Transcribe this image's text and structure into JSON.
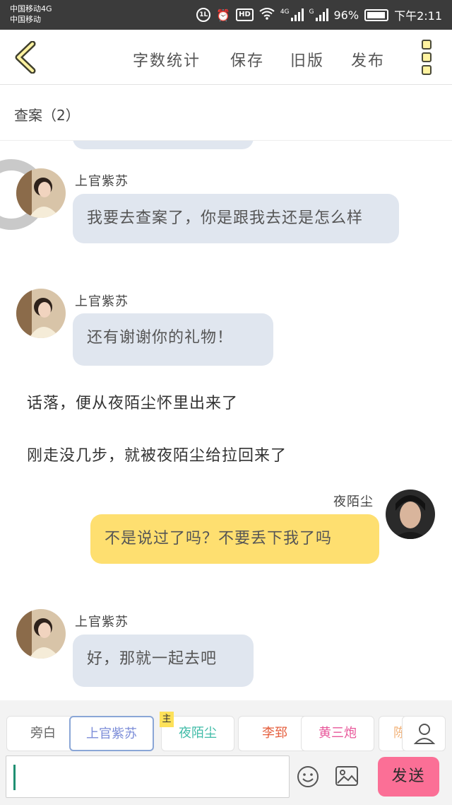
{
  "status_bar": {
    "carrier_line1": "中国移动4G",
    "carrier_line2": "中国移动",
    "network1": "4G",
    "network2": "G",
    "battery_percent": "96%",
    "time": "下午2:11",
    "icons": [
      "hd-voice-icon",
      "alarm-icon",
      "hd-icon",
      "wifi-icon",
      "signal-icon",
      "battery-icon"
    ]
  },
  "toolbar": {
    "back_icon": "chevron-left-icon",
    "items": [
      "字数统计",
      "保存",
      "旧版",
      "发布"
    ],
    "menu_icon": "more-vertical-icon"
  },
  "chapter": {
    "title": "查案（2）"
  },
  "messages": [
    {
      "type": "left",
      "name": "上官紫苏",
      "text": "我要去查案了，你是跟我去还是怎么样"
    },
    {
      "type": "left",
      "name": "上官紫苏",
      "text": "还有谢谢你的礼物！"
    },
    {
      "type": "narration",
      "text": "话落，便从夜陌尘怀里出来了"
    },
    {
      "type": "narration",
      "text": "刚走没几步，就被夜陌尘给拉回来了"
    },
    {
      "type": "right",
      "name": "夜陌尘",
      "text": "不是说过了吗？不要丢下我了吗"
    },
    {
      "type": "left",
      "name": "上官紫苏",
      "text": "好，那就一起去吧"
    }
  ],
  "roles": [
    {
      "label": "旁白",
      "color": "#666666"
    },
    {
      "label": "上官紫苏",
      "color": "#7b8cd8",
      "selected": true
    },
    {
      "label": "夜陌尘",
      "color": "#3fbba7",
      "badge": "主"
    },
    {
      "label": "李郅",
      "color": "#e5603f"
    },
    {
      "label": "黄三炮",
      "color": "#e8579a"
    },
    {
      "label": "陈",
      "color": "#f2b47c"
    }
  ],
  "input": {
    "value": "",
    "send_label": "发送",
    "emoji_icon": "emoji-icon",
    "image_icon": "image-icon",
    "user_icon": "user-icon"
  },
  "colors": {
    "accent_yellow": "#fedf70",
    "bubble_left": "#e0e6ef",
    "send_pink": "#fb6f96"
  }
}
